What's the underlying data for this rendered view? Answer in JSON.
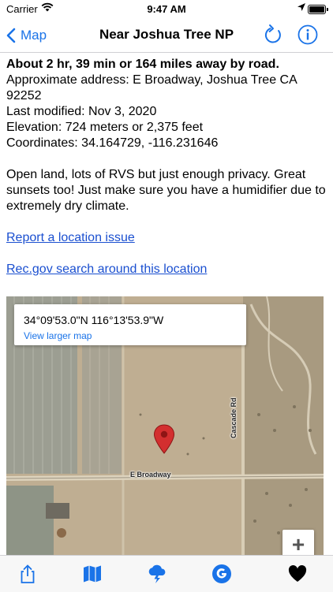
{
  "status_bar": {
    "carrier": "Carrier",
    "time": "9:47 AM"
  },
  "nav": {
    "back_label": "Map",
    "title": "Near Joshua Tree NP"
  },
  "details": {
    "distance": "About 2 hr, 39 min or 164 miles away by road.",
    "address": "Approximate address: E Broadway, Joshua Tree CA 92252",
    "last_modified": "Last modified: Nov 3, 2020",
    "elevation": "Elevation: 724 meters or 2,375 feet",
    "coordinates": "Coordinates: 34.164729, -116.231646",
    "description": "Open land, lots of RVS but just enough privacy. Great sunsets too! Just make sure you have a humidifier due to extremely dry climate.",
    "report_link": "Report a location issue",
    "recgov_link": "Rec.gov search around this location"
  },
  "map": {
    "coords": "34°09'53.0\"N 116°13'53.9\"W",
    "view_larger": "View larger map",
    "road_label": "E Broadway",
    "cross_road_label": "Cascade Rd",
    "zoom_in": "+"
  },
  "tabbar": {
    "items": [
      "share-icon",
      "map-icon",
      "weather-icon",
      "google-icon",
      "heart-icon"
    ]
  },
  "colors": {
    "accent": "#1a73e8",
    "link": "#1a4fd0",
    "pin": "#d32f2f"
  }
}
